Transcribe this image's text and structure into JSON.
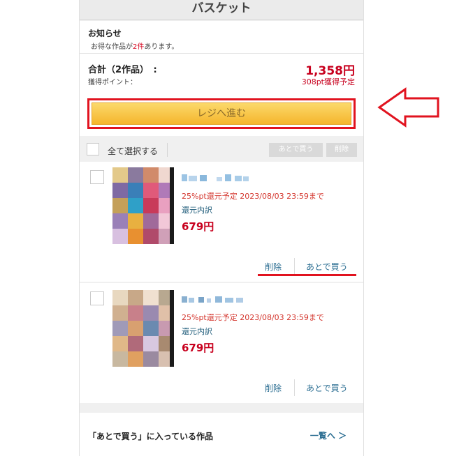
{
  "header": {
    "title": "バスケット"
  },
  "notice": {
    "title": "お知らせ",
    "text_before": "お得な作品が",
    "text_count": "2件",
    "text_after": "あります。"
  },
  "summary": {
    "total_label": "合計（2作品）　:",
    "total_price": "1,358円",
    "points_label": "獲得ポイント：",
    "points_value": "308pt獲得予定",
    "checkout_label": "レジへ進む"
  },
  "toolbar": {
    "select_all_label": "全て選択する",
    "later_button": "あとで買う",
    "delete_button": "削除"
  },
  "items": [
    {
      "campaign": "25%pt還元予定 2023/08/03 23:59まで",
      "breakdown": "還元内訳",
      "price": "679円",
      "delete_label": "削除",
      "later_label": "あとで買う"
    },
    {
      "campaign": "25%pt還元予定 2023/08/03 23:59まで",
      "breakdown": "還元内訳",
      "price": "679円",
      "delete_label": "削除",
      "later_label": "あとで買う"
    }
  ],
  "later_section": {
    "label": "「あとで買う」に入っている作品",
    "link": "一覧へ ＞"
  },
  "colors": {
    "accent_red": "#c8001e",
    "highlight_red": "#e1131f",
    "link_blue": "#2b6e92",
    "button_orange": "#f5b52c"
  },
  "icons": [
    "checkbox-icon",
    "arrow-left-icon",
    "chevron-right-icon"
  ]
}
